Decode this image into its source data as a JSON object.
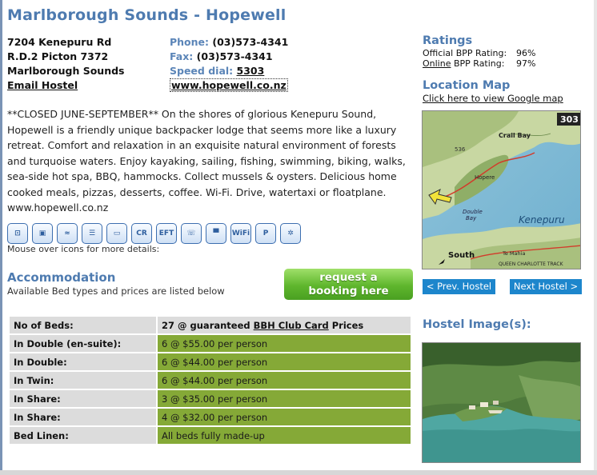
{
  "page": {
    "title": "Marlborough Sounds - Hopewell"
  },
  "address": {
    "line1": "7204 Kenepuru Rd",
    "line2": "R.D.2 Picton 7372",
    "line3": "Marlborough Sounds",
    "email_link": "Email Hostel"
  },
  "contact": {
    "phone_label": "Phone:",
    "phone": "(03)573-4341",
    "fax_label": "Fax:",
    "fax": "(03)573-4341",
    "speed_label": "Speed dial:",
    "speed": "5303",
    "website": "www.hopewell.co.nz"
  },
  "description": "**CLOSED JUNE-SEPTEMBER** On the shores of glorious Kenepuru Sound, Hopewell is a friendly unique backpacker lodge that seems more like a luxury retreat. Comfort and relaxation in an exquisite natural environment of forests and turquoise waters. Enjoy kayaking, sailing, fishing, swimming, biking, walks, sea-side hot spa, BBQ, hammocks. Collect mussels & oysters. Delicious home cooked meals, pizzas, desserts, coffee. Wi-Fi. Drive, watertaxi or floatplane. www.hopewell.co.nz",
  "facility_icons": [
    {
      "name": "double-room-icon",
      "glyph": "⊡"
    },
    {
      "name": "single-room-icon",
      "glyph": "▣"
    },
    {
      "name": "towel-icon",
      "glyph": "≈"
    },
    {
      "name": "linen-icon",
      "glyph": "☰"
    },
    {
      "name": "kitchen-icon",
      "glyph": "▭"
    },
    {
      "name": "credit-card-icon",
      "glyph": "CR"
    },
    {
      "name": "eftpos-icon",
      "glyph": "EFT"
    },
    {
      "name": "phone-icon",
      "glyph": "☏"
    },
    {
      "name": "computer-icon",
      "glyph": "▀"
    },
    {
      "name": "wifi-icon",
      "glyph": "WiFi"
    },
    {
      "name": "parking-icon",
      "glyph": "P"
    },
    {
      "name": "heating-icon",
      "glyph": "✲"
    }
  ],
  "icons_note": "Mouse over icons for more details:",
  "accommodation": {
    "heading": "Accommodation",
    "subtext": "Available Bed types and prices are listed below",
    "book_line1": "request a",
    "book_line2": "booking here"
  },
  "beds": {
    "head_label": "No of Beds:",
    "head_pre": "27 @ guaranteed ",
    "head_link": "BBH Club Card",
    "head_post": " Prices",
    "rows": [
      {
        "label": "In Double (en-suite):",
        "value": "6 @ $55.00 per person"
      },
      {
        "label": "In Double:",
        "value": "6 @ $44.00 per person"
      },
      {
        "label": "In Twin:",
        "value": "6 @ $44.00 per person"
      },
      {
        "label": "In Share:",
        "value": "3 @ $35.00 per person"
      },
      {
        "label": "In Share:",
        "value": "4 @ $32.00 per person"
      },
      {
        "label": "Bed Linen:",
        "value": "All beds fully made-up"
      }
    ]
  },
  "ratings": {
    "heading": "Ratings",
    "official_label": "Official BPP Rating:",
    "official_value": "96%",
    "online_link": "Online",
    "online_label": " BPP Rating:",
    "online_value": "97%"
  },
  "location": {
    "heading": "Location Map",
    "map_link": "Click here to view Google map",
    "map_number": "303",
    "map_labels": [
      "Crail Bay",
      "Hopere",
      "Double Bay",
      "Kenepuru",
      "South",
      "Te Mahia",
      "QUEEN CHARLOTTE TRACK",
      "536"
    ]
  },
  "nav": {
    "prev": "< Prev. Hostel",
    "next": "Next Hostel >"
  },
  "images": {
    "heading": "Hostel Image(s):"
  },
  "colors": {
    "heading_blue": "#4e7bb0",
    "table_green": "#85a937",
    "button_green": "#5fb62d",
    "nav_blue": "#1d86cc"
  }
}
